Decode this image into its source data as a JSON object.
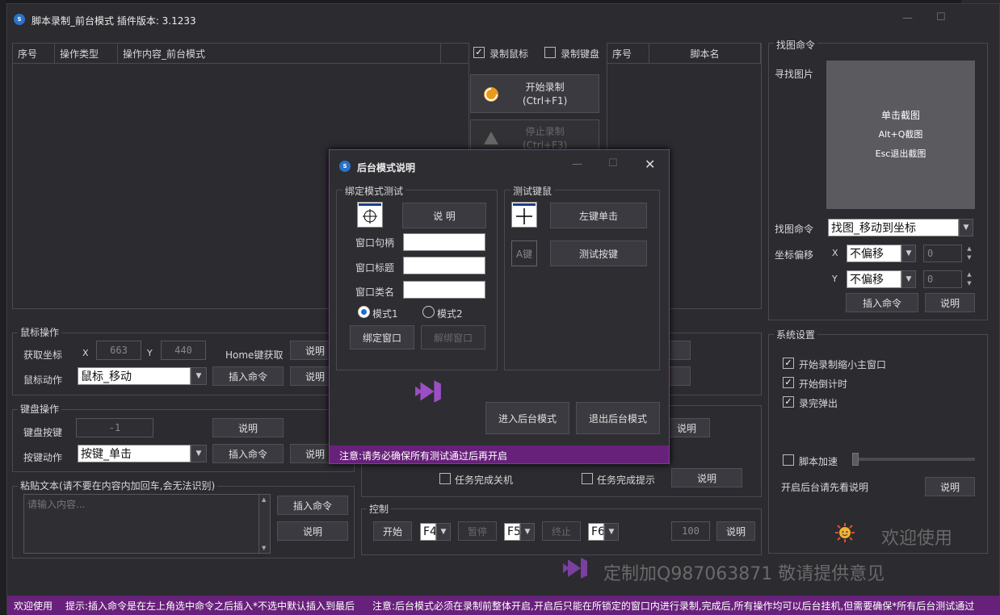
{
  "main": {
    "title": "脚本录制_前台模式  插件版本: 3.1233",
    "app_icon": "script",
    "op_table": {
      "headers": [
        "序号",
        "操作类型",
        "操作内容_前台模式"
      ]
    },
    "record_mouse": "录制鼠标",
    "record_keyboard": "录制键盘",
    "start_record": {
      "line1": "开始录制",
      "line2": "(Ctrl+F1)"
    },
    "stop_record": {
      "line1": "停止录制",
      "line2": "(Ctrl+F3)"
    },
    "script_table": {
      "headers": [
        "序号",
        "脚本名"
      ]
    },
    "mouse_group": {
      "title": "鼠标操作",
      "get_coord": "获取坐标",
      "x_label": "X",
      "x_value": "663",
      "y_label": "Y",
      "y_value": "440",
      "home_hint": "Home键获取",
      "help": "说明",
      "action_label": "鼠标动作",
      "action_value": "鼠标_移动",
      "insert": "插入命令"
    },
    "keyboard_group": {
      "title": "键盘操作",
      "key_label": "键盘按键",
      "key_value": "-1",
      "help": "说明",
      "action_label": "按键动作",
      "action_value": "按键_单击",
      "insert": "插入命令"
    },
    "paste_group": {
      "title": "粘贴文本(请不要在内容内加回车,会无法识别)",
      "placeholder": "请输入内容...",
      "insert": "插入命令",
      "help": "说明"
    },
    "middle": {
      "shutdown": "任务完成关机",
      "notify": "任务完成提示",
      "help": "说明",
      "control": {
        "title": "控制",
        "start": "开始",
        "start_key": "F4",
        "pause": "暂停",
        "pause_key": "F5",
        "stop": "终止",
        "stop_key": "F6",
        "count": "100",
        "help": "说明"
      }
    },
    "find_image": {
      "title": "找图命令",
      "find_label": "寻找图片",
      "capture_lines": [
        "单击截图",
        "Alt+Q截图",
        "Esc退出截图"
      ],
      "cmd_label": "找图命令",
      "cmd_value": "找图_移动到坐标",
      "offset_label": "坐标偏移",
      "x_label": "X",
      "x_value": "不偏移",
      "x_num": "0",
      "y_label": "Y",
      "y_value": "不偏移",
      "y_num": "0",
      "insert": "插入命令",
      "help": "说明"
    },
    "system": {
      "title": "系统设置",
      "options": [
        "开始录制缩小主窗口",
        "开始倒计时",
        "录完弹出"
      ],
      "speedup": "脚本加速",
      "bg_hint": "开启后台请先看说明",
      "help": "说明",
      "welcome": "欢迎使用"
    },
    "promo": "定制加Q987063871  敬请提供意见",
    "status": {
      "left": "欢迎使用",
      "tip": "提示:插入命令是在左上角选中命令之后插入*不选中默认插入到最后",
      "notice": "注意:后台模式必须在录制前整体开启,开启后只能在所锁定的窗口内进行录制,完成后,所有操作均可以后台挂机,但需要确保*所有后台测试通过"
    }
  },
  "dialog": {
    "title": "后台模式说明",
    "bind_group": {
      "title": "绑定模式测试",
      "help": "说    明",
      "handle": "窗口句柄",
      "caption": "窗口标题",
      "class": "窗口类名",
      "mode1": "模式1",
      "mode2": "模式2",
      "bind": "绑定窗口",
      "unbind": "解绑窗口"
    },
    "test_group": {
      "title": "测试键鼠",
      "left_click": "左键单击",
      "test_key": "测试按键",
      "key_icon_text": "A键"
    },
    "enter_bg": "进入后台模式",
    "exit_bg": "退出后台模式",
    "footer": "注意:请务必确保所有测试通过后再开启"
  },
  "colors": {
    "accent": "#68217a",
    "bg": "#2b2b30",
    "border": "#4a4a50"
  }
}
